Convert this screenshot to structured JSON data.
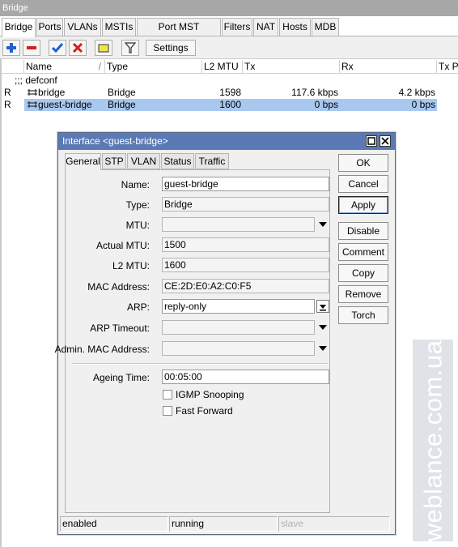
{
  "window": {
    "title": "Bridge"
  },
  "tabs": [
    "Bridge",
    "Ports",
    "VLANs",
    "MSTIs",
    "Port MST Overrides",
    "Filters",
    "NAT",
    "Hosts",
    "MDB"
  ],
  "toolbar": {
    "settings_label": "Settings"
  },
  "table": {
    "columns": [
      "Name",
      "Type",
      "L2 MTU",
      "Tx",
      "Rx",
      "Tx Pa"
    ],
    "group_label": ";;; defconf",
    "rows": [
      {
        "flag": "R",
        "name": "bridge",
        "type": "Bridge",
        "l2mtu": "1598",
        "tx": "117.6 kbps",
        "rx": "4.2 kbps"
      },
      {
        "flag": "R",
        "name": "guest-bridge",
        "type": "Bridge",
        "l2mtu": "1600",
        "tx": "0 bps",
        "rx": "0 bps"
      }
    ]
  },
  "dialog": {
    "title": "Interface <guest-bridge>",
    "tabs": [
      "General",
      "STP",
      "VLAN",
      "Status",
      "Traffic"
    ],
    "fields": {
      "name": {
        "label": "Name:",
        "value": "guest-bridge"
      },
      "type": {
        "label": "Type:",
        "value": "Bridge"
      },
      "mtu": {
        "label": "MTU:",
        "value": ""
      },
      "actual_mtu": {
        "label": "Actual MTU:",
        "value": "1500"
      },
      "l2_mtu": {
        "label": "L2 MTU:",
        "value": "1600"
      },
      "mac": {
        "label": "MAC Address:",
        "value": "CE:2D:E0:A2:C0:F5"
      },
      "arp": {
        "label": "ARP:",
        "value": "reply-only"
      },
      "arp_timeout": {
        "label": "ARP Timeout:",
        "value": ""
      },
      "admin_mac": {
        "label": "Admin. MAC Address:",
        "value": ""
      },
      "ageing": {
        "label": "Ageing Time:",
        "value": "00:05:00"
      }
    },
    "checkboxes": {
      "igmp": "IGMP Snooping",
      "fast_forward": "Fast Forward"
    },
    "buttons": [
      "OK",
      "Cancel",
      "Apply",
      "Disable",
      "Comment",
      "Copy",
      "Remove",
      "Torch"
    ],
    "status": [
      "enabled",
      "running",
      "slave"
    ]
  },
  "watermark": "weblance.com.ua",
  "colors": {
    "title_bar": "#5b7ab5",
    "selected_row": "#a9c8ef",
    "add_icon": "#1f5fd1",
    "remove_icon": "#d22020"
  }
}
